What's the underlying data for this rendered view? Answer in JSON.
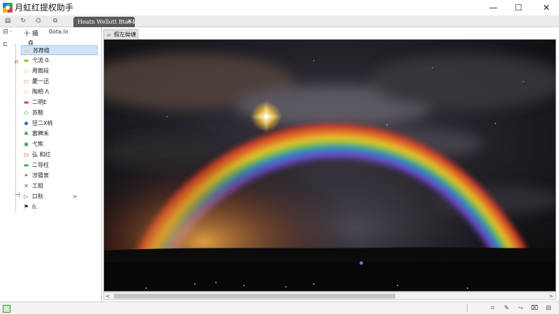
{
  "window": {
    "title": "月虹红提权助手",
    "minimize_glyph": "—",
    "maximize_glyph": "☐",
    "close_glyph": "✕"
  },
  "tabs": {
    "toolbar_icons": [
      "sidebar-icon",
      "refresh-icon",
      "tag-icon",
      "copy-icon"
    ],
    "active_tab_label": "Heatn Wellott Bta64",
    "close_glyph": "✕"
  },
  "left_panel": {
    "toolbar": {
      "left_glyph": "⊟ ·",
      "mid_label": "十 攝",
      "right_label": "0ota.lo"
    },
    "row2_glyph": "⊏",
    "row2_label": "森",
    "items": [
      {
        "label": "苏荐缆",
        "icon": "folder-icon",
        "color": "#e8a35a",
        "glyph": "▭",
        "selected": true
      },
      {
        "label": "弋流 0.",
        "icon": "bar-icon",
        "color": "#9bbd2c",
        "glyph": "▬",
        "selected": false
      },
      {
        "label": "用簡段",
        "icon": "folder-icon",
        "color": "#f0c050",
        "glyph": "▭",
        "selected": false
      },
      {
        "label": "慶一迅",
        "icon": "image-icon",
        "color": "#c98b86",
        "glyph": "▭",
        "selected": false
      },
      {
        "label": "陶相 Λ",
        "icon": "folder-icon",
        "color": "#f5c542",
        "glyph": "▭",
        "selected": false
      },
      {
        "label": "二明E",
        "icon": "line-icon",
        "color": "#d0443a",
        "glyph": "▬",
        "selected": false
      },
      {
        "label": "苏鞍",
        "icon": "diamond-outline-icon",
        "color": "#2e7d32",
        "glyph": "◇",
        "selected": false
      },
      {
        "label": "弪二X桃",
        "icon": "diamond-icon",
        "color": "#1e63c8",
        "glyph": "◆",
        "selected": false
      },
      {
        "label": "雾稗禾",
        "icon": "plant-icon",
        "color": "#3a9a3a",
        "glyph": "♣",
        "selected": false
      },
      {
        "label": "弋熊",
        "icon": "refresh-circle-icon",
        "color": "#2f8f3a",
        "glyph": "◉",
        "selected": false
      },
      {
        "label": "弘 和红",
        "icon": "window-icon",
        "color": "#b04040",
        "glyph": "▭",
        "selected": false
      },
      {
        "label": "二导枉",
        "icon": "dash-icon",
        "color": "#3aa84a",
        "glyph": "▬",
        "selected": false
      },
      {
        "label": "渉猜衷",
        "icon": "arrow-icon",
        "color": "#c33",
        "glyph": "✦",
        "selected": false
      },
      {
        "label": "工照",
        "icon": "cross-icon",
        "color": "#2f5fa8",
        "glyph": "✕",
        "selected": false
      },
      {
        "label": "口秋",
        "icon": "play-icon",
        "color": "#555",
        "glyph": "▷",
        "selected": false,
        "arrow": ">"
      },
      {
        "label": "0.",
        "icon": "flag-icon",
        "color": "#222",
        "glyph": "⚑",
        "selected": false
      }
    ],
    "side_marks": [
      {
        "glyph": "ዐ",
        "color": "#c33"
      },
      {
        "glyph": "⊣",
        "color": "#444"
      }
    ]
  },
  "view": {
    "tab_label": "假左拗缠",
    "tab_icon": "▱"
  },
  "scrollbar": {
    "left_glyph": "<",
    "right_glyph": ">",
    "position": 0.0,
    "thumb_fraction": 0.65
  },
  "status_bar": {
    "left_badge": "⬚",
    "icons": [
      {
        "name": "crop-icon",
        "glyph": "⌗"
      },
      {
        "name": "pen-icon",
        "glyph": "✎"
      },
      {
        "name": "share-icon",
        "glyph": "⤳"
      },
      {
        "name": "chat-icon",
        "glyph": "⌧"
      },
      {
        "name": "grid-icon",
        "glyph": "⊟"
      }
    ]
  }
}
